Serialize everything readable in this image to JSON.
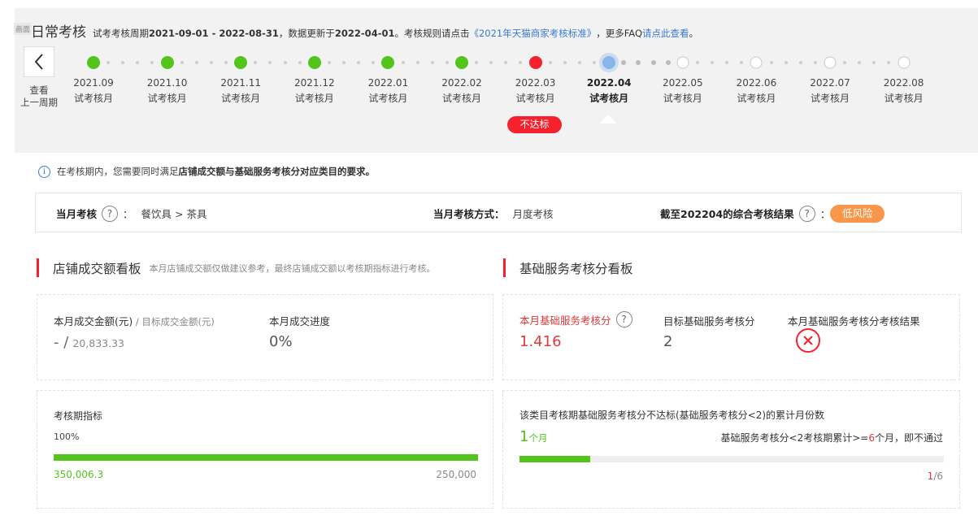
{
  "header": {
    "corner_tag": "画面",
    "title": "日常考核",
    "period_prefix": "试考考核周期",
    "period": "2021-09-01 - 2022-08-31",
    "updated_prefix": "，数据更新于",
    "updated": "2022-04-01",
    "rules_prefix": "。考核规则请点击",
    "rules_link": "《2021年天猫商家考核标准》",
    "faq_prefix": "，更多FAQ",
    "faq_link": "请点此查看",
    "faq_suffix": "。"
  },
  "timeline": {
    "prev_label_1": "查看",
    "prev_label_2": "上一周期",
    "months": [
      {
        "date": "2021.09",
        "label": "试考核月",
        "status": "pass"
      },
      {
        "date": "2021.10",
        "label": "试考核月",
        "status": "pass"
      },
      {
        "date": "2021.11",
        "label": "试考核月",
        "status": "pass"
      },
      {
        "date": "2021.12",
        "label": "试考核月",
        "status": "pass"
      },
      {
        "date": "2022.01",
        "label": "试考核月",
        "status": "pass"
      },
      {
        "date": "2022.02",
        "label": "试考核月",
        "status": "pass"
      },
      {
        "date": "2022.03",
        "label": "试考核月",
        "status": "fail"
      },
      {
        "date": "2022.04",
        "label": "试考核月",
        "status": "current"
      },
      {
        "date": "2022.05",
        "label": "试考核月",
        "status": "future"
      },
      {
        "date": "2022.06",
        "label": "试考核月",
        "status": "future"
      },
      {
        "date": "2022.07",
        "label": "试考核月",
        "status": "future"
      },
      {
        "date": "2022.08",
        "label": "试考核月",
        "status": "future"
      }
    ],
    "fail_badge": "不达标"
  },
  "notice": {
    "prefix": "在考核期内，您需要同时满足",
    "strong": "店铺成交额与基础服务考核分对应类目的要求。"
  },
  "summary": {
    "assess_label": "当月考核",
    "colon": "：",
    "category": "餐饮具 > 茶具",
    "method_label": "当月考核方式：",
    "method": "月度考核",
    "result_label": "截至202204的综合考核结果",
    "risk": "低风险"
  },
  "sales": {
    "title": "店铺成交额看板",
    "note": "本月店铺成交额仅做建议参考，最终店铺成交额以考核期指标进行考核。",
    "amount_label": "本月成交金额(元)",
    "target_label": " / 目标成交金额(元)",
    "amount_value": "- /",
    "target_value": "20,833.33",
    "progress_label": "本月成交进度",
    "progress_value": "0%",
    "period_label": "考核期指标",
    "period_pct_text": "100%",
    "period_progress": 1.0,
    "achieved": "350,006.3",
    "target": "250,000"
  },
  "service": {
    "title": "基础服务考核分看板",
    "score_label": "本月基础服务考核分",
    "score_value": "1.416",
    "target_label": "目标基础服务考核分",
    "target_value": "2",
    "result_label": "本月基础服务考核分考核结果",
    "fail_count_label": "该类目考核期基础服务考核分不达标(基础服务考核分<2)的累计月份数",
    "fail_count": "1",
    "fail_unit": "个月",
    "rule_prefix": "基础服务考核分<2考核期累计>=",
    "rule_num": "6",
    "rule_suffix": "个月，即不通过",
    "progress_fraction": 0.1667,
    "ratio_num": "1",
    "ratio_den": "/6"
  },
  "colors": {
    "green": "#52c41a",
    "red": "#f5222d",
    "blue": "#3a78d4",
    "orange": "#f9964a"
  }
}
